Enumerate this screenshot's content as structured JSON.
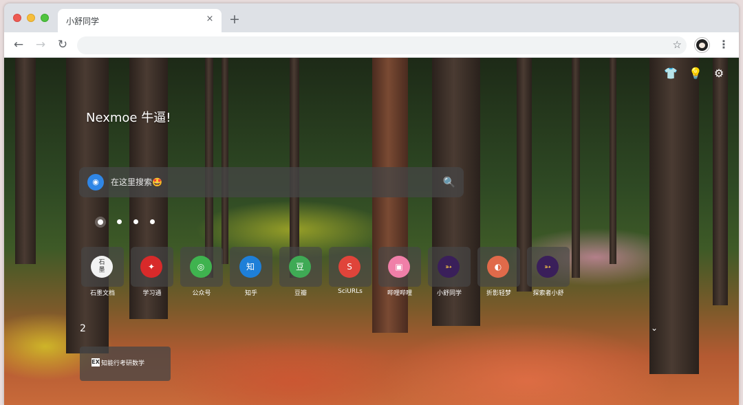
{
  "tab": {
    "title": "小舒同学",
    "close": "×",
    "new_tab": "+"
  },
  "toolbar": {
    "back": "←",
    "forward": "→",
    "reload": "↻",
    "star": "☆",
    "menu": "⋮"
  },
  "top_icons": {
    "shirt": "👕",
    "bulb": "💡",
    "gear": "⚙"
  },
  "greeting": "Nexmoe 牛逼!",
  "search": {
    "placeholder": "在这里搜索🤩",
    "engine_icon": "◉",
    "button_icon": "🔍"
  },
  "pager": {
    "pages": 4,
    "active": 0
  },
  "shortcuts": [
    {
      "label": "石墨文档",
      "icon_text": "石墨",
      "color": "#f2f2f2",
      "text_color": "#333333"
    },
    {
      "label": "学习通",
      "icon_text": "✦",
      "color": "#d82a2a",
      "text_color": "#ffffff"
    },
    {
      "label": "公众号",
      "icon_text": "◎",
      "color": "#3fb34f",
      "text_color": "#ffffff"
    },
    {
      "label": "知乎",
      "icon_text": "知",
      "color": "#1e7fd8",
      "text_color": "#ffffff"
    },
    {
      "label": "豆瓣",
      "icon_text": "豆",
      "color": "#3faa55",
      "text_color": "#ffffff"
    },
    {
      "label": "SciURLs",
      "icon_text": "S",
      "color": "#e0443a",
      "text_color": "#ffffff"
    },
    {
      "label": "哔哩哔哩",
      "icon_text": "▣",
      "color": "#f07fa8",
      "text_color": "#ffffff"
    },
    {
      "label": "小舒同学",
      "icon_text": "➳",
      "color": "#3a1f5a",
      "text_color": "#ffcc44"
    },
    {
      "label": "折影轻梦",
      "icon_text": "◐",
      "color": "#e06a4a",
      "text_color": "#ffffff"
    },
    {
      "label": "探索者小舒",
      "icon_text": "➳",
      "color": "#3a1f5a",
      "text_color": "#ffcc44"
    }
  ],
  "folder": {
    "number": "2",
    "chevron": "⌄",
    "item_icon": "EX",
    "item_label": "知能行考研数学"
  }
}
